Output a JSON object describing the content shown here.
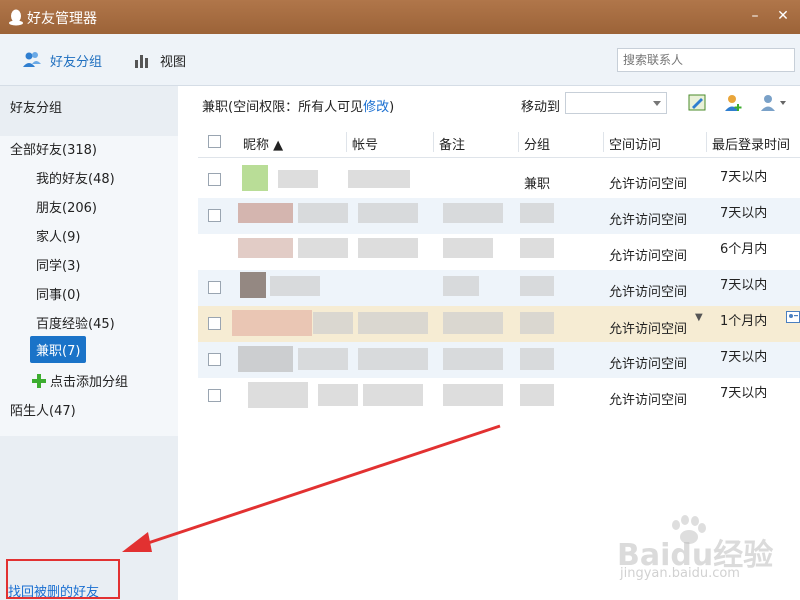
{
  "window": {
    "title": "好友管理器",
    "minimize_icon": "minimize-icon",
    "close_icon": "close-icon"
  },
  "toolbar": {
    "group_label": "好友分组",
    "view_label": "视图",
    "search_placeholder": "搜索联系人"
  },
  "sidebar": {
    "header": "好友分组",
    "groups": [
      {
        "label": "全部好友(318)"
      },
      {
        "label": "我的好友(48)"
      },
      {
        "label": "朋友(206)"
      },
      {
        "label": "家人(9)"
      },
      {
        "label": "同学(3)"
      },
      {
        "label": "同事(0)"
      },
      {
        "label": "百度经验(45)"
      },
      {
        "label": "兼职(7)",
        "selected": true
      },
      {
        "label": "陌生人(47)"
      }
    ],
    "add_group": "点击添加分组",
    "recover_link": "找回被删的好友"
  },
  "main": {
    "group_info_prefix": "兼职(空间权限：所有人可见",
    "group_info_link": "修改",
    "group_info_suffix": ")",
    "move_to_label": "移动到",
    "columns": [
      "昵称",
      "帐号",
      "备注",
      "分组",
      "空间访问",
      "最后登录时间"
    ],
    "rows": [
      {
        "group": "兼职",
        "access": "允许访问空间",
        "last_login": "7天以内"
      },
      {
        "group": "",
        "access": "允许访问空间",
        "last_login": "7天以内"
      },
      {
        "group": "",
        "access": "允许访问空间",
        "last_login": "6个月内"
      },
      {
        "group": "",
        "access": "允许访问空间",
        "last_login": "7天以内"
      },
      {
        "group": "",
        "access": "允许访问空间",
        "last_login": "1个月内"
      },
      {
        "group": "",
        "access": "允许访问空间",
        "last_login": "7天以内"
      },
      {
        "group": "",
        "access": "允许访问空间",
        "last_login": "7天以内"
      }
    ]
  },
  "watermark": {
    "brand": "Baidu经验",
    "site": "jingyan.baidu.com"
  },
  "colors": {
    "titlebar": "#a66b40",
    "accent": "#1a73c8",
    "link": "#1a6fd1",
    "annotation": "#e23131",
    "highlight_row": "#f6ecd3"
  }
}
